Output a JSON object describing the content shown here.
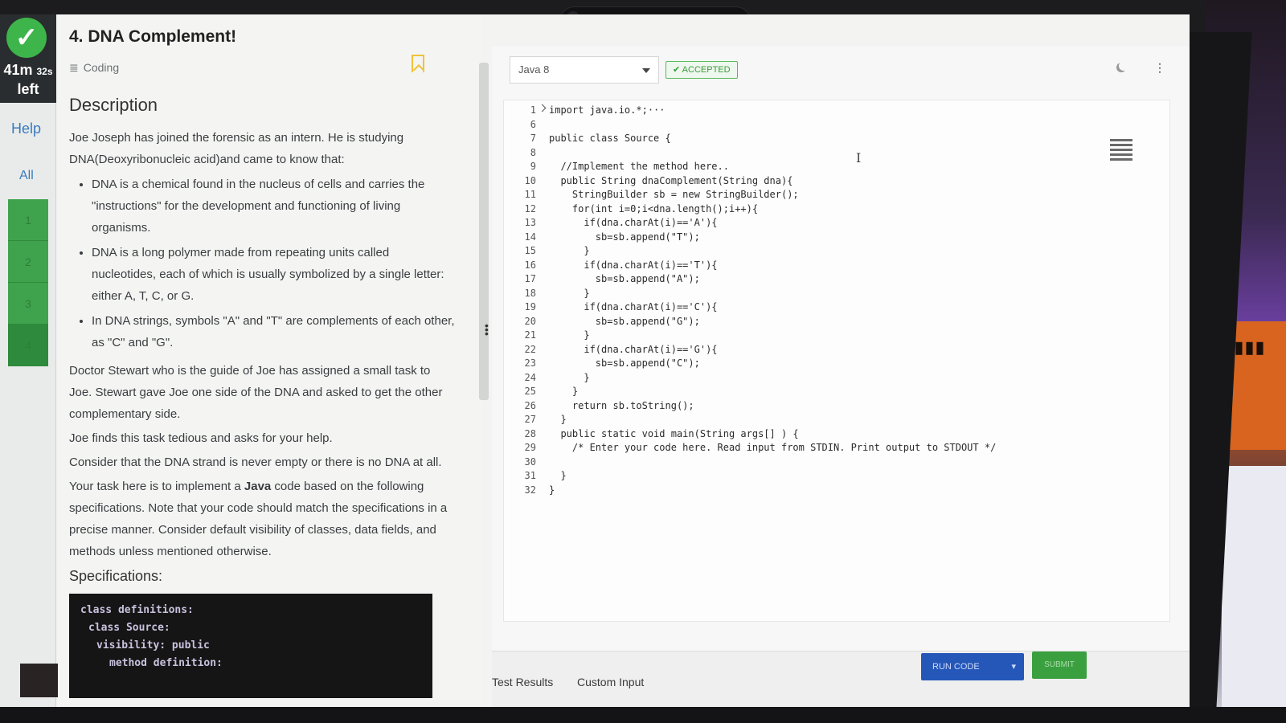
{
  "timer": {
    "minutes": "41m",
    "seconds": "32s",
    "suffix": "left"
  },
  "rail": {
    "help_label": "Help",
    "all_label": "All",
    "questions": [
      "1",
      "2",
      "3",
      "4"
    ]
  },
  "problem": {
    "title": "4. DNA Complement!",
    "tag": "Coding",
    "description_heading": "Description",
    "intro": "Joe Joseph has joined the forensic as an intern. He is studying DNA(Deoxyribonucleic acid)and came to know that:",
    "bullets": [
      "DNA is a chemical found in the nucleus of cells and carries the \"instructions\" for the development and functioning of living organisms.",
      "DNA is a long polymer made from repeating units called nucleotides, each of which is usually symbolized by a single letter: either A, T, C, or G.",
      "In DNA strings, symbols \"A\" and \"T\" are complements of each other, as \"C\" and \"G\"."
    ],
    "paragraphs": [
      "Doctor Stewart who is the guide of Joe has assigned a small task to Joe. Stewart gave Joe one side of the DNA and asked to get the other complementary side.",
      "Joe finds this task tedious and asks for your help.",
      "Consider that the DNA strand is never empty or there is no DNA at all."
    ],
    "task_before": "Your task here is to implement a ",
    "task_bold": "Java",
    "task_after": " code based on the following specifications. Note that your code should match the specifications in a precise manner. Consider default visibility of classes, data fields, and methods unless mentioned otherwise.",
    "specs_heading": "Specifications:",
    "specs_lines": [
      "class definitions:",
      "class Source:",
      "visibility: public",
      "method definition:"
    ]
  },
  "editor": {
    "language": "Java 8",
    "status": "ACCEPTED",
    "line_numbers": [
      "1",
      "6",
      "7",
      "8",
      "9",
      "10",
      "11",
      "12",
      "13",
      "14",
      "15",
      "16",
      "17",
      "18",
      "19",
      "20",
      "21",
      "22",
      "23",
      "24",
      "25",
      "26",
      "27",
      "28",
      "29",
      "30",
      "31",
      "32"
    ],
    "code_lines": [
      "import java.io.*;···",
      "",
      "public class Source {",
      "",
      "  //Implement the method here..",
      "  public String dnaComplement(String dna){",
      "    StringBuilder sb = new StringBuilder();",
      "    for(int i=0;i<dna.length();i++){",
      "      if(dna.charAt(i)=='A'){",
      "        sb=sb.append(\"T\");",
      "      }",
      "      if(dna.charAt(i)=='T'){",
      "        sb=sb.append(\"A\");",
      "      }",
      "      if(dna.charAt(i)=='C'){",
      "        sb=sb.append(\"G\");",
      "      }",
      "      if(dna.charAt(i)=='G'){",
      "        sb=sb.append(\"C\");",
      "      }",
      "    }",
      "    return sb.toString();",
      "  }",
      "  public static void main(String args[] ) {",
      "    /* Enter your code here. Read input from STDIN. Print output to STDOUT */",
      "",
      "  }",
      "}"
    ]
  },
  "bottom": {
    "tab_results": "Test Results",
    "tab_custom": "Custom Input",
    "run_label": "RUN CODE",
    "submit_label": "SUBMIT"
  },
  "colors": {
    "accent_blue": "#2457b8",
    "success_green": "#3aa03f",
    "bookmark_yellow": "#f0c23a"
  }
}
